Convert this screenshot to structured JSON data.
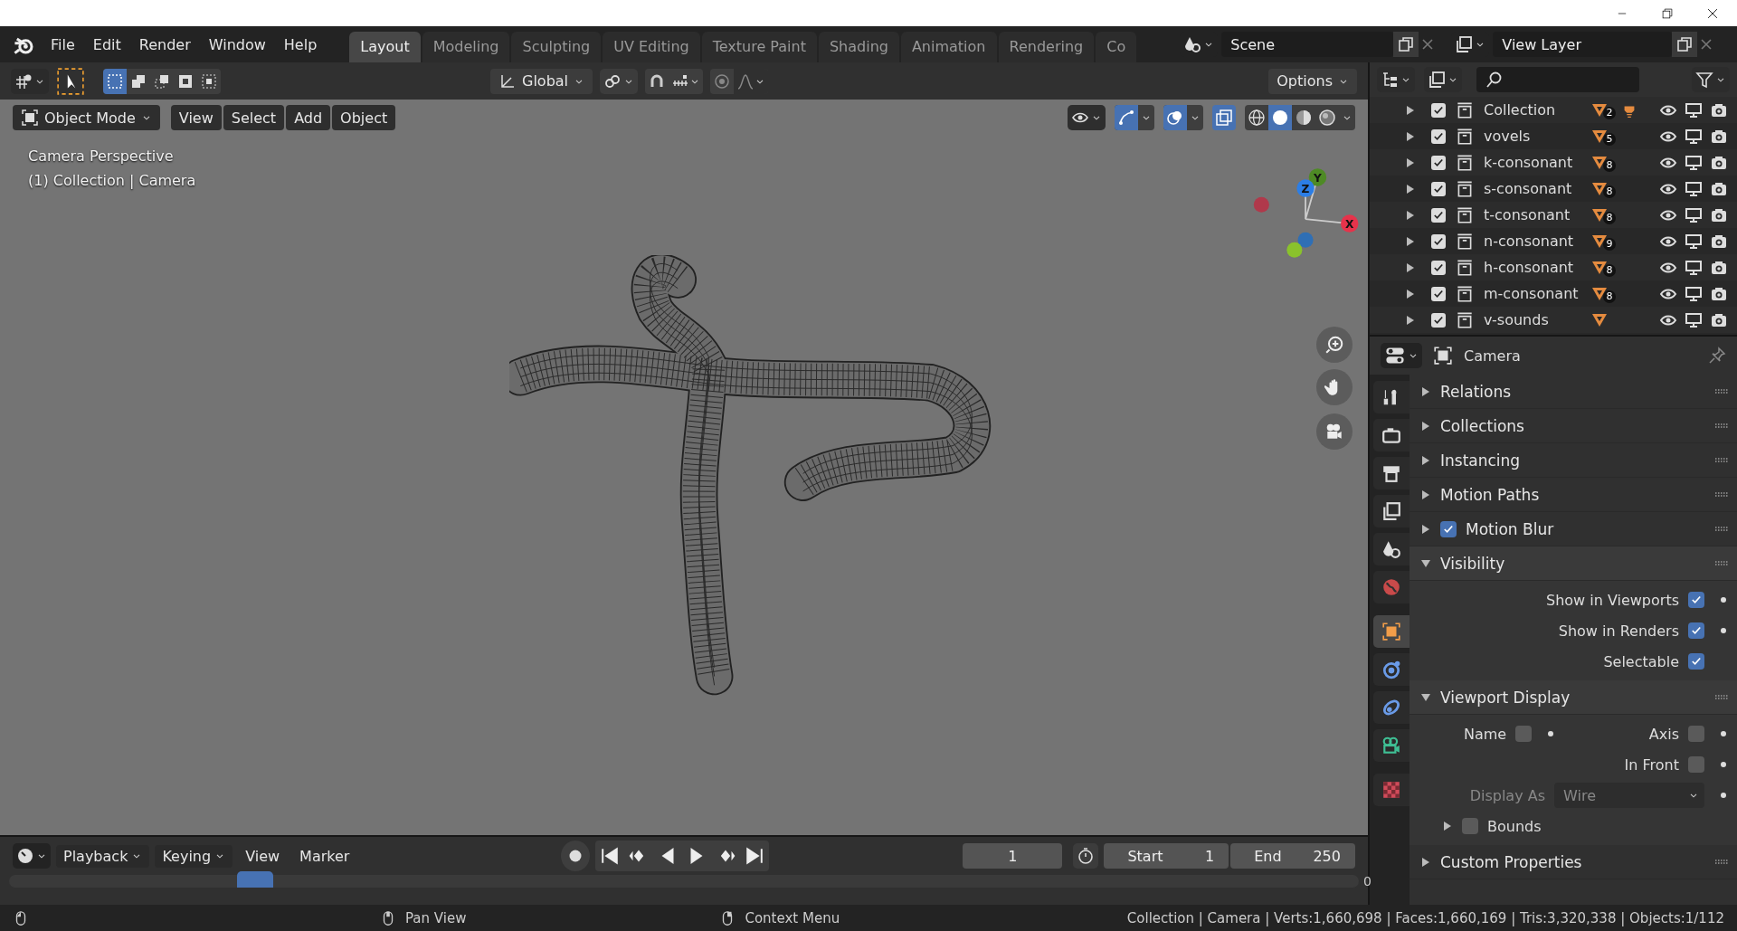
{
  "menu": [
    "File",
    "Edit",
    "Render",
    "Window",
    "Help"
  ],
  "workspaces": [
    {
      "label": "Layout",
      "selected": true
    },
    {
      "label": "Modeling",
      "selected": false
    },
    {
      "label": "Sculpting",
      "selected": false
    },
    {
      "label": "UV Editing",
      "selected": false
    },
    {
      "label": "Texture Paint",
      "selected": false
    },
    {
      "label": "Shading",
      "selected": false
    },
    {
      "label": "Animation",
      "selected": false
    },
    {
      "label": "Rendering",
      "selected": false
    },
    {
      "label": "Co",
      "selected": false
    }
  ],
  "scene": {
    "value": "Scene"
  },
  "view_layer": {
    "value": "View Layer"
  },
  "tool_header": {
    "select_modes": [
      {
        "selected": true
      },
      {
        "selected": false
      },
      {
        "selected": false
      },
      {
        "selected": false
      },
      {
        "selected": false
      }
    ],
    "orientation": "Global",
    "options": "Options"
  },
  "viewport": {
    "mode": "Object Mode",
    "menus": [
      "View",
      "Select",
      "Add",
      "Object"
    ],
    "shading": [
      {
        "selected": false
      },
      {
        "selected": true
      },
      {
        "selected": false
      },
      {
        "selected": false
      }
    ],
    "info": [
      "Camera Perspective",
      "(1) Collection | Camera"
    ],
    "axes": [
      "Y",
      "Z",
      "X"
    ]
  },
  "outliner": {
    "rows": [
      {
        "name": "Collection",
        "count": "2",
        "checked": true,
        "light": true
      },
      {
        "name": "vovels",
        "count": "5",
        "checked": true,
        "light": false
      },
      {
        "name": "k-consonant",
        "count": "8",
        "checked": true,
        "light": false
      },
      {
        "name": "s-consonant",
        "count": "8",
        "checked": true,
        "light": false
      },
      {
        "name": "t-consonant",
        "count": "8",
        "checked": true,
        "light": false
      },
      {
        "name": "n-consonant",
        "count": "9",
        "checked": true,
        "light": false
      },
      {
        "name": "h-consonant",
        "count": "8",
        "checked": true,
        "light": false
      },
      {
        "name": "m-consonant",
        "count": "8",
        "checked": true,
        "light": false
      },
      {
        "name": "v-sounds",
        "checked": true,
        "light": false
      }
    ]
  },
  "properties": {
    "title": "Camera",
    "tabs": [
      {
        "kind": "tool",
        "selected": false
      },
      {
        "kind": "render",
        "selected": false
      },
      {
        "kind": "output",
        "selected": false
      },
      {
        "kind": "view-layer",
        "selected": false
      },
      {
        "kind": "scene",
        "selected": false
      },
      {
        "kind": "world",
        "selected": false
      },
      {
        "kind": "object",
        "selected": true
      },
      {
        "kind": "physics",
        "selected": false
      },
      {
        "kind": "constraints",
        "selected": false
      },
      {
        "kind": "data",
        "selected": false
      },
      {
        "kind": "texture",
        "selected": false
      }
    ],
    "sections": [
      {
        "label": "Relations",
        "expanded": false
      },
      {
        "label": "Collections",
        "expanded": false
      },
      {
        "label": "Instancing",
        "expanded": false
      },
      {
        "label": "Motion Paths",
        "expanded": false
      },
      {
        "label": "Motion Blur",
        "expanded": false,
        "checked": true
      },
      {
        "label": "Visibility",
        "expanded": true,
        "fields": [
          {
            "kind": "check",
            "label": "Show in Viewports",
            "checked": true,
            "dot": true
          },
          {
            "kind": "check",
            "label": "Show in Renders",
            "checked": true,
            "dot": true
          },
          {
            "kind": "check",
            "label": "Selectable",
            "checked": true,
            "dot": false
          }
        ]
      },
      {
        "label": "Viewport Display",
        "expanded": true,
        "fields": [
          {
            "kind": "pair",
            "items": [
              {
                "label": "Name",
                "checked": false
              },
              {
                "label": "Axis",
                "checked": false
              }
            ]
          },
          {
            "kind": "check",
            "label": "In Front",
            "checked": false,
            "dot": true
          },
          {
            "kind": "select",
            "label": "Display As",
            "value": "Wire",
            "disabled": true
          },
          {
            "kind": "subpanel",
            "label": "Bounds",
            "checked": false,
            "expanded": false
          }
        ]
      },
      {
        "label": "Custom Properties",
        "expanded": false
      }
    ]
  },
  "timeline": {
    "menus": [
      {
        "label": "Playback",
        "dropdown": true
      },
      {
        "label": "Keying",
        "dropdown": true
      },
      {
        "label": "View",
        "dropdown": false
      },
      {
        "label": "Marker",
        "dropdown": false
      }
    ],
    "current_frame": "1",
    "start_label": "Start",
    "start": "1",
    "end_label": "End",
    "end": "250",
    "ruler_label": "0"
  },
  "status_bar": {
    "hints": [
      "Pan View",
      "Context Menu"
    ],
    "stats": "Collection | Camera | Verts:1,660,698 | Faces:1,660,169 | Tris:3,320,338 | Objects:1/112"
  }
}
